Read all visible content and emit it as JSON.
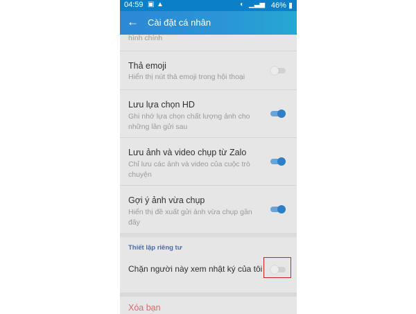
{
  "status_bar": {
    "time": "04:59",
    "battery": "46%"
  },
  "header": {
    "title": "Cài đặt cá nhân"
  },
  "settings": {
    "partial_top": "hình chính",
    "items": [
      {
        "title": "Thả emoji",
        "desc": "Hiển thị nút thả emoji trong hội thoại",
        "toggle": "off"
      },
      {
        "title": "Lưu lựa chọn HD",
        "desc": "Ghi nhớ lựa chọn chất lượng ảnh cho những lần gửi sau",
        "toggle": "on"
      },
      {
        "title": "Lưu ảnh và video chụp từ Zalo",
        "desc": "Chỉ lưu các ảnh và video của cuộc trò chuyện",
        "toggle": "on"
      },
      {
        "title": "Gợi ý ảnh vừa chụp",
        "desc": "Hiển thị đề xuất gửi ảnh vừa chụp gần đây",
        "toggle": "on"
      }
    ]
  },
  "privacy": {
    "section_title": "Thiết lập riêng tư",
    "block_diary_label": "Chặn người này xem nhật ký của tôi",
    "block_diary_toggle": "off"
  },
  "actions": {
    "delete_friend": "Xóa bạn"
  },
  "icons": [
    "back-arrow-icon",
    "warning-icon",
    "image-icon",
    "wifi-icon",
    "signal-icon",
    "battery-icon"
  ],
  "colors": {
    "accent": "#2d87d5",
    "toggle_on": "#2f7fc8",
    "delete_text": "#d96a6a",
    "highlight_border": "#d32020"
  }
}
